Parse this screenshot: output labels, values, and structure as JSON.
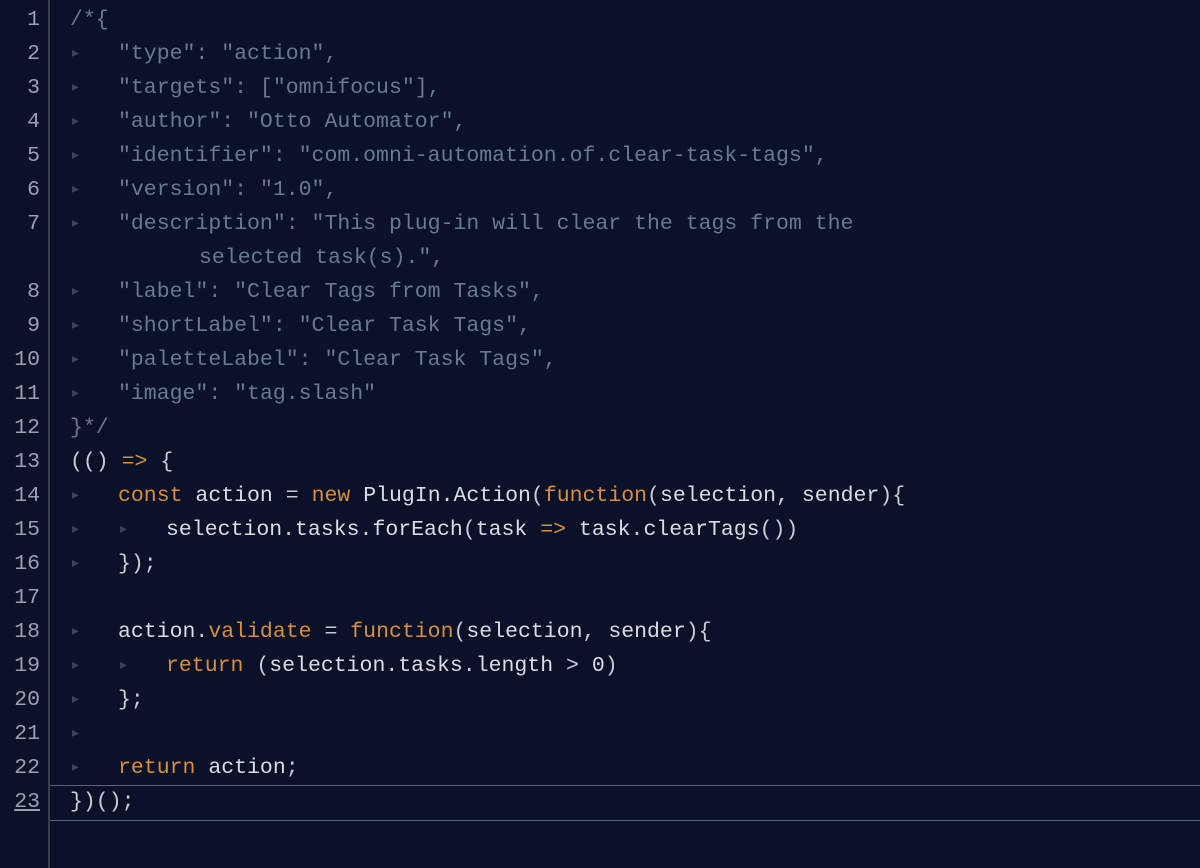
{
  "editor": {
    "current_line": 23,
    "line_count": 23,
    "indent_marker": "▸",
    "wrap_indent_spaces": "          ",
    "lines": {
      "1": "/*{",
      "2": "    \"type\": \"action\",",
      "3": "    \"targets\": [\"omnifocus\"],",
      "4": "    \"author\": \"Otto Automator\",",
      "5": "    \"identifier\": \"com.omni-automation.of.clear-task-tags\",",
      "6": "    \"version\": \"1.0\",",
      "7": "    \"description\": \"This plug-in will clear the tags from the",
      "7b": "selected task(s).\",",
      "8": "    \"label\": \"Clear Tags from Tasks\",",
      "9": "    \"shortLabel\": \"Clear Task Tags\",",
      "10": "    \"paletteLabel\": \"Clear Task Tags\",",
      "11": "    \"image\": \"tag.slash\"",
      "12": "}*/",
      "13": "(() => {",
      "14": "    const action = new PlugIn.Action(function(selection, sender){",
      "15": "        selection.tasks.forEach(task => task.clearTags())",
      "16": "    });",
      "17": "",
      "18": "    action.validate = function(selection, sender){",
      "19": "        return (selection.tasks.length > 0)",
      "20": "    };",
      "21": "    ",
      "22": "    return action;",
      "23": "})();"
    },
    "tokens": {
      "comment_open": "/*{",
      "comment_close": "}*/",
      "kw_const": "const",
      "kw_new": "new",
      "kw_function": "function",
      "kw_return": "return",
      "ident_action": "action",
      "ident_PlugInAction": "PlugIn.Action",
      "ident_selection": "selection",
      "ident_sender": "sender",
      "ident_tasks": "tasks",
      "ident_forEach": "forEach",
      "ident_task": "task",
      "ident_clearTags": "clearTags",
      "ident_validate": "validate",
      "ident_length": "length",
      "str_type_k": "\"type\"",
      "str_type_v": "\"action\"",
      "str_targets_k": "\"targets\"",
      "str_targets_v": "\"omnifocus\"",
      "str_author_k": "\"author\"",
      "str_author_v": "\"Otto Automator\"",
      "str_identifier_k": "\"identifier\"",
      "str_identifier_v": "\"com.omni-automation.of.clear-task-tags\"",
      "str_version_k": "\"version\"",
      "str_version_v": "\"1.0\"",
      "str_description_k": "\"description\"",
      "str_description_v1": "\"This plug-in will clear the tags from the ",
      "str_description_v2": "selected task(s).\"",
      "str_label_k": "\"label\"",
      "str_label_v": "\"Clear Tags from Tasks\"",
      "str_shortLabel_k": "\"shortLabel\"",
      "str_shortLabel_v": "\"Clear Task Tags\"",
      "str_paletteLabel_k": "\"paletteLabel\"",
      "str_paletteLabel_v": "\"Clear Task Tags\"",
      "str_image_k": "\"image\"",
      "str_image_v": "\"tag.slash\""
    }
  },
  "colors": {
    "background": "#0a1128",
    "gutter_border": "#3a4052",
    "line_number": "#9aa0b1",
    "indent_guide": "#3a4256",
    "comment": "#6a7a8e",
    "string": "#c5cdd3",
    "keyword": "#d68f3e",
    "default_text": "#c9cdd6",
    "active_line_border": "#5a6378"
  }
}
